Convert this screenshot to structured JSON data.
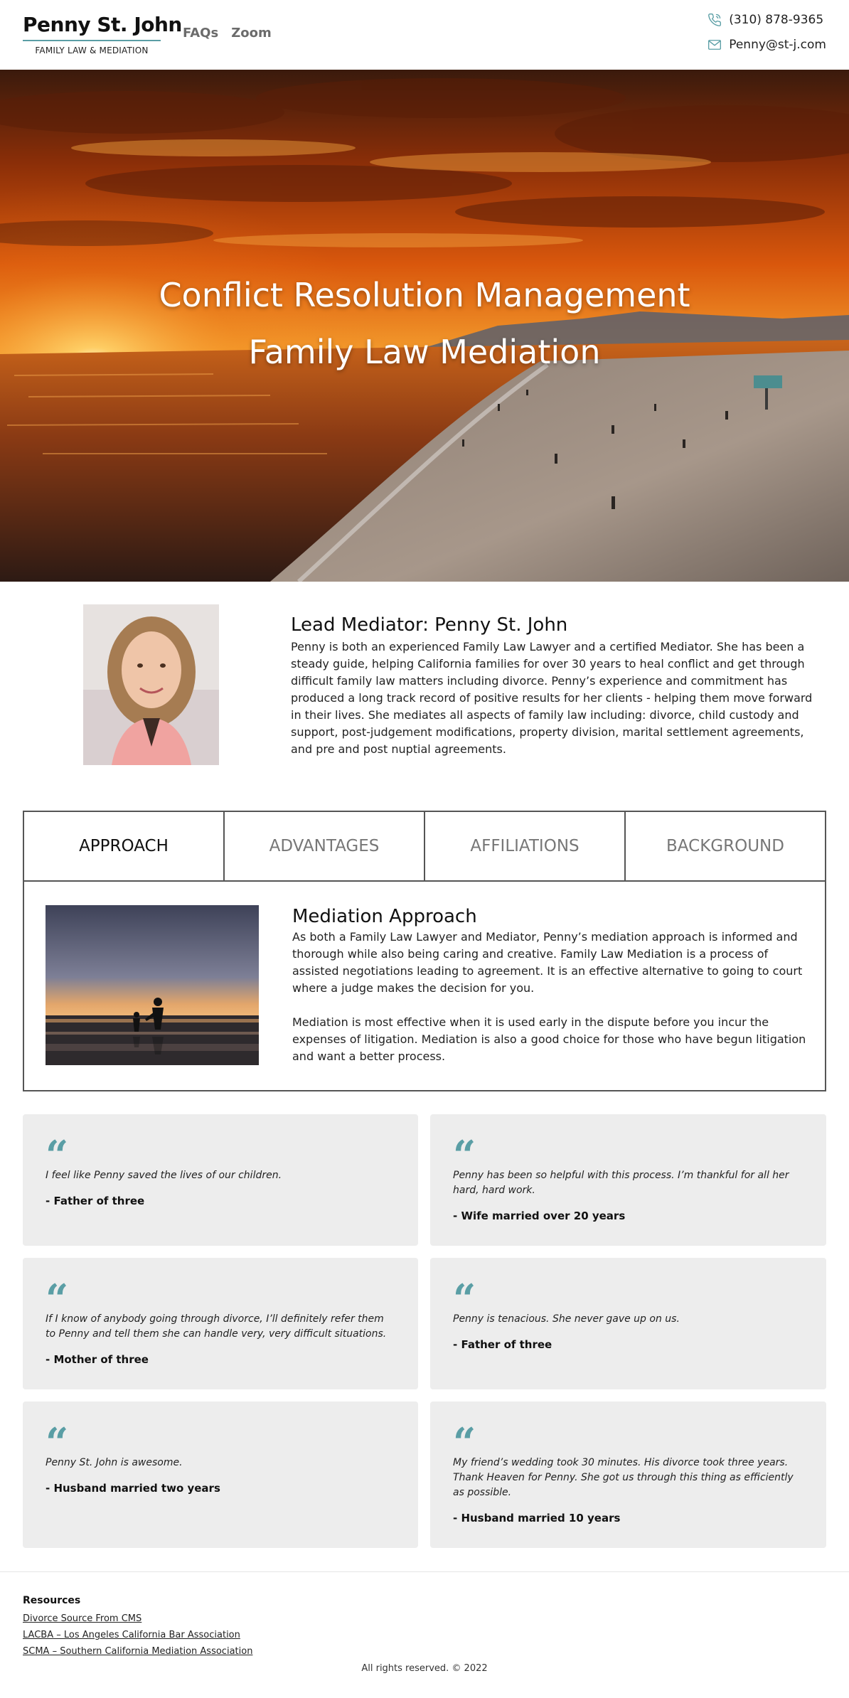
{
  "header": {
    "brand_name": "Penny St. John",
    "brand_tagline": "FAMILY LAW & MEDIATION",
    "nav": [
      "FAQs",
      "Zoom"
    ],
    "phone": "(310) 878-9365",
    "email": "Penny@st-j.com",
    "accent_color": "#5a9ea5"
  },
  "hero": {
    "line1": "Conflict Resolution Management",
    "line2": "Family Law Mediation"
  },
  "bio": {
    "title": "Lead Mediator: Penny St. John",
    "body": "Penny is both an experienced Family Law Lawyer and a certified Mediator. She has been a steady guide, helping California families for over 30 years to heal conflict and get through difficult family law matters including divorce. Penny’s experience and commitment has produced a long track record of positive results for her clients - helping them move forward in their lives. She mediates all aspects of family law including: divorce, child custody and support, post-judgement modifications, property division, marital settlement agreements, and pre and post nuptial agreements."
  },
  "tabs": {
    "items": [
      "APPROACH",
      "ADVANTAGES",
      "AFFILIATIONS",
      "BACKGROUND"
    ],
    "active": "APPROACH",
    "panel": {
      "title": "Mediation Approach",
      "para1": "As both a Family Law Lawyer and Mediator, Penny’s mediation approach is informed and thorough while also being caring and creative. Family Law Mediation is a process of assisted negotiations leading to agreement. It is an effective alternative to going to court where a judge makes the decision for you.",
      "para2": "Mediation is most effective when it is used early in the dispute before you incur the expenses of litigation. Mediation is also a good choice for those who have begun litigation and want a better process."
    }
  },
  "testimonials": [
    {
      "quote": "I feel like Penny saved the lives of our children.",
      "author": "- Father of three"
    },
    {
      "quote": "Penny has been so helpful with this process. I’m thankful for all her hard, hard work.",
      "author": "- Wife married over 20 years"
    },
    {
      "quote": "If I know of anybody going through divorce, I’ll definitely refer them to Penny and tell them she can handle very, very difficult situations.",
      "author": "- Mother of three"
    },
    {
      "quote": "Penny is tenacious. She never gave up on us.",
      "author": "- Father of three"
    },
    {
      "quote": "Penny St. John is awesome.",
      "author": "- Husband married two years"
    },
    {
      "quote": "My friend’s wedding took 30 minutes. His divorce took three years. Thank Heaven for Penny. She got us through this thing as efficiently as possible.",
      "author": "- Husband married 10 years"
    }
  ],
  "quote_mark": "“",
  "footer": {
    "resources_title": "Resources",
    "links": [
      "Divorce Source From CMS",
      "LACBA – Los Angeles California Bar Association",
      "SCMA – Southern California Mediation Association"
    ],
    "copyright": "All rights reserved. © 2022"
  }
}
